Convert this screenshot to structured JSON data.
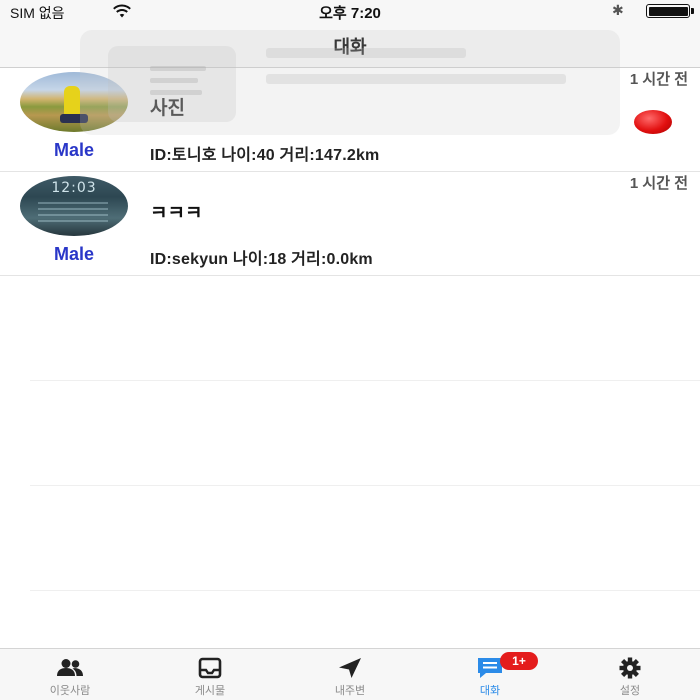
{
  "status_bar": {
    "carrier": "SIM 없음",
    "time": "오후 7:20",
    "bluetooth_icon": "bluetooth-icon",
    "battery_level": 1.0
  },
  "nav": {
    "title": "대화"
  },
  "conversations": [
    {
      "avatar": "photo-person-field",
      "gender": "Male",
      "title": "사진",
      "info": "ID:토니호 나이:40 거리:147.2km",
      "time": "1 시간 전",
      "unread": true
    },
    {
      "avatar": "photo-phone-lockscreen",
      "avatar_clock": "12:03",
      "gender": "Male",
      "title": "ㅋㅋㅋ",
      "info": "ID:sekyun 나이:18 거리:0.0km",
      "time": "1 시간 전",
      "unread": false
    }
  ],
  "tab_bar": {
    "tabs": [
      {
        "label": "이웃사람",
        "icon": "people-icon",
        "active": false
      },
      {
        "label": "게시물",
        "icon": "inbox-icon",
        "active": false
      },
      {
        "label": "내주변",
        "icon": "location-arrow-icon",
        "active": false
      },
      {
        "label": "대화",
        "icon": "chat-icon",
        "active": true,
        "badge": "1+"
      },
      {
        "label": "설정",
        "icon": "gear-icon",
        "active": false
      }
    ]
  },
  "colors": {
    "accent_blue": "#2b8be8",
    "gender_blue": "#2a37c8",
    "badge_red": "#e41c1c",
    "bar_bg": "#f7f7f7"
  }
}
